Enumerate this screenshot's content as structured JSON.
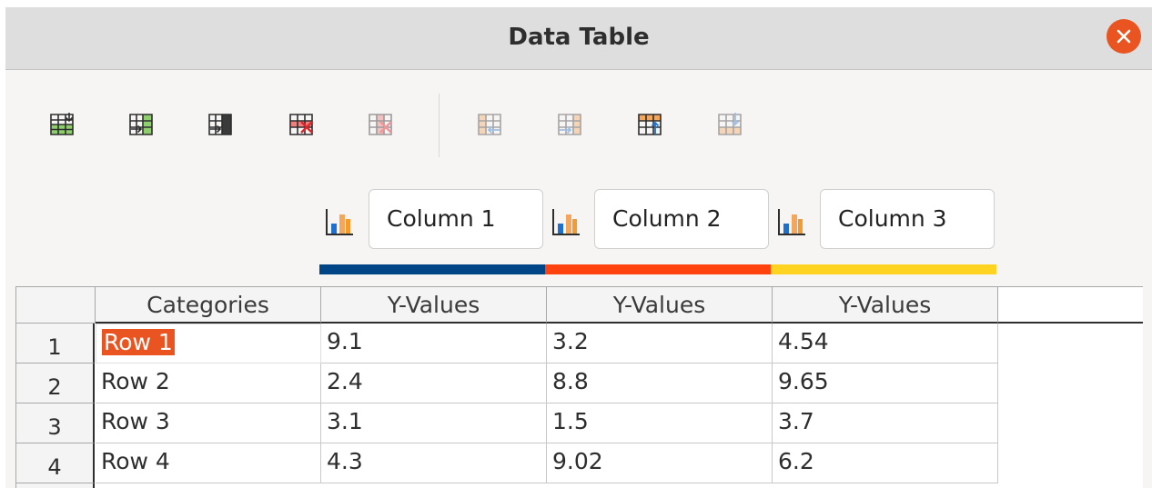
{
  "dialog": {
    "title": "Data Table"
  },
  "toolbar": {
    "buttons": [
      {
        "icon": "insert-row-icon",
        "enabled": true
      },
      {
        "icon": "insert-series-icon",
        "enabled": true
      },
      {
        "icon": "insert-text-column-icon",
        "enabled": true
      },
      {
        "icon": "delete-row-icon",
        "enabled": true
      },
      {
        "icon": "delete-series-icon",
        "enabled": false
      },
      {
        "icon": "move-series-left-icon",
        "enabled": false
      },
      {
        "icon": "move-series-right-icon",
        "enabled": false
      },
      {
        "icon": "move-row-up-icon",
        "enabled": true
      },
      {
        "icon": "move-row-down-icon",
        "enabled": false
      }
    ]
  },
  "series": [
    {
      "name": "Column 1",
      "color": "#004586"
    },
    {
      "name": "Column 2",
      "color": "#ff420e"
    },
    {
      "name": "Column 3",
      "color": "#ffd320"
    }
  ],
  "table": {
    "headers": [
      "Categories",
      "Y-Values",
      "Y-Values",
      "Y-Values"
    ],
    "rows": [
      {
        "num": "1",
        "cells": [
          "Row 1",
          "9.1",
          "3.2",
          "4.54"
        ]
      },
      {
        "num": "2",
        "cells": [
          "Row 2",
          "2.4",
          "8.8",
          "9.65"
        ]
      },
      {
        "num": "3",
        "cells": [
          "Row 3",
          "3.1",
          "1.5",
          "3.7"
        ]
      },
      {
        "num": "4",
        "cells": [
          "Row 4",
          "4.3",
          "9.02",
          "6.2"
        ]
      }
    ],
    "active_cell": "Row 1"
  }
}
